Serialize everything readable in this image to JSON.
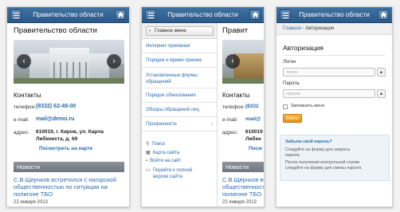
{
  "panel1": {
    "title": "Правительство области",
    "page_heading": "Правительство области",
    "contacts_heading": "Контакты",
    "phone_label": "телефон:",
    "phone_value": "(8332) 62-48-00",
    "email_label": "e-mail:",
    "email_value": "mail@demo.ru",
    "address_label": "адрес:",
    "address_line1": "610019, г. Киров, ул. Карла",
    "address_line2": "Либкнехта, д. 69",
    "map_link": "Посмотреть на карте",
    "news_heading": "Новости",
    "news_title_line1": "С.В.Щерчков встретился с нагорской",
    "news_title_line2": "общественностью по ситуации на",
    "news_title_line3": "полигоне ТБО",
    "news_date": "22 января 2013"
  },
  "panel2": {
    "title": "Правительство области",
    "back_button": "Главное меню",
    "menu_items": [
      "Интернет-приемная",
      "Порядок и время приема",
      "Установленные формы",
      "обращений",
      "Порядок обжалования",
      "Обзоры обращений лиц",
      "Прозрачность"
    ],
    "tools": [
      "Поиск",
      "Карта сайта",
      "Войти на сайт",
      "Перейти к полной",
      "версии сайта"
    ],
    "peek_heading": "Правит",
    "peek_contacts": "Контакты",
    "peek_phone_label": "телефон:",
    "peek_phone": "(8332",
    "peek_email_label": "e-mail:",
    "peek_email": "mail@",
    "peek_address_label": "адрес:",
    "peek_address1": "610019",
    "peek_address2": "Либкн",
    "peek_map": "Посм",
    "news_heading": "Новости",
    "news_title_line1": "С.В.Щерчков встретился с нагорской",
    "news_title_line2": "общественностью по ситуации на",
    "news_title_line3": "полигоне ТБО",
    "news_date": "22 января 2013"
  },
  "panel3": {
    "title": "Правительство области",
    "crumb_home": "Главная",
    "crumb_sep": "›",
    "crumb_current": "Авторизация",
    "heading": "Авторизация",
    "login_label": "Логин",
    "login_placeholder": "логин",
    "password_label": "Пароль",
    "password_placeholder": "пароль",
    "remember_label": "Запомнить меня",
    "submit_button": "Войти",
    "forgot_heading": "Забыли свой пароль?",
    "forgot_line1": "Следуйте на форму для запроса",
    "forgot_line2": "пароля.",
    "forgot_line3": "После получения контрольной строки",
    "forgot_line4": "следуйте на форму для смены пароля."
  },
  "icons": {
    "menu": "hamburger-icon",
    "home": "home-icon",
    "prev": "chevron-left-icon",
    "next": "chevron-right-icon",
    "search": "search-icon",
    "sitemap": "sitemap-icon",
    "login": "user-icon",
    "fullversion": "desktop-icon",
    "warning": "warning-icon"
  },
  "colors": {
    "header": "#34638f",
    "link": "#2a6cb0",
    "news_bar": "#7e858b",
    "button_orange": "#f0a02c"
  }
}
